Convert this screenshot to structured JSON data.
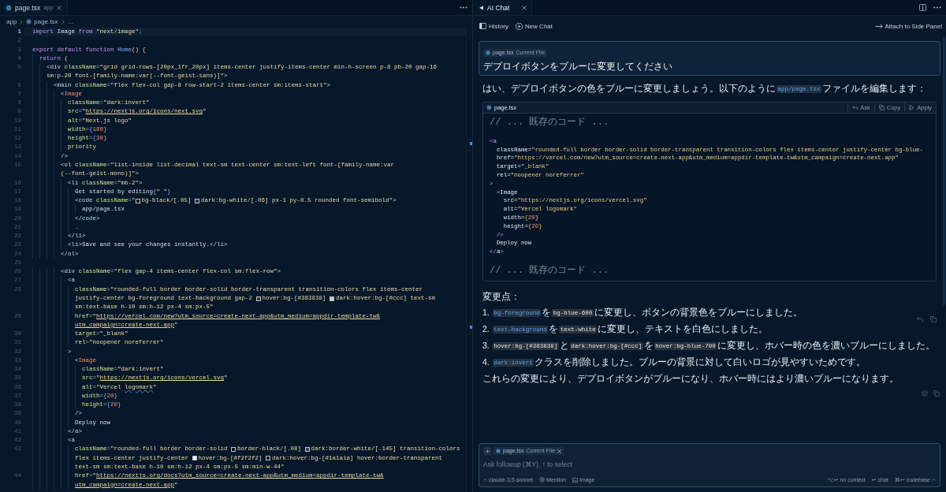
{
  "editor": {
    "tab": {
      "name": "page.tsx",
      "folder": "app",
      "selected": true
    },
    "breadcrumb": {
      "folder": "app",
      "file": "page.tsx",
      "more": "…"
    },
    "lines": [
      {
        "number": "1",
        "current": true,
        "rows": [
          {
            "tokens": [
              {
                "kind": "kw",
                "text": "import"
              },
              {
                "kind": "text",
                "text": " Image "
              },
              {
                "kind": "kw",
                "text": "from "
              },
              {
                "kind": "str",
                "text": "\"next/image\""
              },
              {
                "kind": "punct",
                "text": ";"
              }
            ]
          }
        ]
      },
      {
        "number": "2",
        "current": false
      },
      {
        "number": "3",
        "current": false,
        "rows": [
          {
            "tokens": [
              {
                "kind": "kw",
                "text": "export default function "
              },
              {
                "kind": "fn",
                "text": "Home"
              },
              {
                "kind": "paren",
                "text": "() {"
              }
            ]
          }
        ]
      },
      {
        "number": "4",
        "current": false,
        "rows": [
          {
            "tokens": [
              {
                "kind": "kw",
                "text": "  return "
              },
              {
                "kind": "paren",
                "text": "("
              }
            ]
          }
        ]
      },
      {
        "number": "5",
        "current": false,
        "rows": [
          {
            "tokens": [
              {
                "kind": "tag",
                "text": "    <div "
              },
              {
                "kind": "attr",
                "text": "className"
              },
              {
                "kind": "punct",
                "text": "="
              },
              {
                "kind": "str",
                "text": "\"grid grid-rows-[20px_1fr_20px] items-center justify-items-center min-h-screen p-8 pb-20 gap-16"
              }
            ]
          },
          {
            "tokens": [
              {
                "kind": "str",
                "text": "    sm:p-20 font-[family-name:var(--font-geist-sans)]\""
              },
              {
                "kind": "tag",
                "text": ">"
              }
            ]
          }
        ]
      },
      {
        "number": "6",
        "current": false,
        "rows": [
          {
            "tokens": [
              {
                "kind": "tag",
                "text": "      <main "
              },
              {
                "kind": "attr",
                "text": "className"
              },
              {
                "kind": "punct",
                "text": "="
              },
              {
                "kind": "str",
                "text": "\"flex flex-col gap-8 row-start-2 items-center sm:items-start\""
              },
              {
                "kind": "tag",
                "text": ">"
              }
            ]
          }
        ]
      },
      {
        "number": "7",
        "current": false,
        "rows": [
          {
            "tokens": [
              {
                "kind": "tag",
                "text": "        <"
              },
              {
                "kind": "comp",
                "text": "Image"
              }
            ]
          }
        ]
      },
      {
        "number": "8",
        "current": false,
        "rows": [
          {
            "tokens": [
              {
                "kind": "attr",
                "text": "          className"
              },
              {
                "kind": "punct",
                "text": "="
              },
              {
                "kind": "str",
                "text": "\"dark:invert\""
              }
            ]
          }
        ]
      },
      {
        "number": "9",
        "current": false,
        "rows": [
          {
            "tokens": [
              {
                "kind": "attr",
                "text": "          src"
              },
              {
                "kind": "punct",
                "text": "="
              },
              {
                "kind": "str",
                "text": "\""
              },
              {
                "kind": "url",
                "text": "https://nextjs.org/icons/next.svg"
              },
              {
                "kind": "str",
                "text": "\""
              }
            ]
          }
        ]
      },
      {
        "number": "10",
        "current": false,
        "rows": [
          {
            "tokens": [
              {
                "kind": "attr",
                "text": "          alt"
              },
              {
                "kind": "punct",
                "text": "="
              },
              {
                "kind": "str",
                "text": "\"Next.js logo\""
              }
            ]
          }
        ]
      },
      {
        "number": "11",
        "current": false,
        "rows": [
          {
            "tokens": [
              {
                "kind": "attr",
                "text": "          width"
              },
              {
                "kind": "punct",
                "text": "="
              },
              {
                "kind": "brace",
                "text": "{"
              },
              {
                "kind": "num",
                "text": "180"
              },
              {
                "kind": "brace",
                "text": "}"
              }
            ]
          }
        ]
      },
      {
        "number": "12",
        "current": false,
        "rows": [
          {
            "tokens": [
              {
                "kind": "attr",
                "text": "          height"
              },
              {
                "kind": "punct",
                "text": "="
              },
              {
                "kind": "brace",
                "text": "{"
              },
              {
                "kind": "num",
                "text": "38"
              },
              {
                "kind": "brace",
                "text": "}"
              }
            ]
          }
        ]
      },
      {
        "number": "13",
        "current": false,
        "rows": [
          {
            "tokens": [
              {
                "kind": "attr",
                "text": "          priority"
              }
            ]
          }
        ]
      },
      {
        "number": "14",
        "current": false,
        "rows": [
          {
            "tokens": [
              {
                "kind": "tag",
                "text": "        />"
              }
            ]
          }
        ]
      },
      {
        "number": "15",
        "current": false,
        "rows": [
          {
            "tokens": [
              {
                "kind": "tag",
                "text": "        <ol "
              },
              {
                "kind": "attr",
                "text": "className"
              },
              {
                "kind": "punct",
                "text": "="
              },
              {
                "kind": "str",
                "text": "\"list-inside list-decimal text-sm text-center sm:text-left font-[family-name:var"
              }
            ]
          },
          {
            "tokens": [
              {
                "kind": "str",
                "text": "        (--font-geist-mono)]\""
              },
              {
                "kind": "tag",
                "text": ">"
              }
            ]
          }
        ]
      },
      {
        "number": "16",
        "current": false,
        "rows": [
          {
            "tokens": [
              {
                "kind": "tag",
                "text": "          <li "
              },
              {
                "kind": "attr",
                "text": "className"
              },
              {
                "kind": "punct",
                "text": "="
              },
              {
                "kind": "str",
                "text": "\"mb-2\""
              },
              {
                "kind": "tag",
                "text": ">"
              }
            ]
          }
        ]
      },
      {
        "number": "17",
        "current": false,
        "rows": [
          {
            "tokens": [
              {
                "kind": "text",
                "text": "            Get started by editing"
              },
              {
                "kind": "brace",
                "text": "{"
              },
              {
                "kind": "str",
                "text": "\" \""
              },
              {
                "kind": "brace",
                "text": "}"
              }
            ]
          }
        ]
      },
      {
        "number": "18",
        "current": false,
        "rows": [
          {
            "tokens": [
              {
                "kind": "tag",
                "text": "            <code "
              },
              {
                "kind": "attr",
                "text": "className"
              },
              {
                "kind": "punct",
                "text": "="
              },
              {
                "kind": "str",
                "text": "\""
              },
              {
                "kind": "swatch",
                "color": "#0e1116"
              },
              {
                "kind": "str",
                "text": "bg-black/[.05] "
              },
              {
                "kind": "swatch",
                "color": "#2a2f37"
              },
              {
                "kind": "str",
                "text": "dark:bg-white/[.06] px-1 py-0.5 rounded font-semibold\""
              },
              {
                "kind": "tag",
                "text": ">"
              }
            ]
          }
        ]
      },
      {
        "number": "19",
        "current": false,
        "rows": [
          {
            "tokens": [
              {
                "kind": "text",
                "text": "              app/page.tsx"
              }
            ]
          }
        ]
      },
      {
        "number": "20",
        "current": false,
        "rows": [
          {
            "tokens": [
              {
                "kind": "tag",
                "text": "            </code>"
              }
            ]
          }
        ]
      },
      {
        "number": "21",
        "current": false,
        "rows": [
          {
            "tokens": [
              {
                "kind": "text",
                "text": "            ."
              }
            ]
          }
        ]
      },
      {
        "number": "22",
        "current": false,
        "rows": [
          {
            "tokens": [
              {
                "kind": "tag",
                "text": "          </li>"
              }
            ]
          }
        ]
      },
      {
        "number": "23",
        "current": false,
        "rows": [
          {
            "tokens": [
              {
                "kind": "tag",
                "text": "          <li>"
              },
              {
                "kind": "text",
                "text": "Save and see your changes instantly."
              },
              {
                "kind": "tag",
                "text": "</li>"
              }
            ]
          }
        ]
      },
      {
        "number": "24",
        "current": false,
        "rows": [
          {
            "tokens": [
              {
                "kind": "tag",
                "text": "        </ol>"
              }
            ]
          }
        ]
      },
      {
        "number": "25",
        "current": false
      },
      {
        "number": "26",
        "current": false,
        "rows": [
          {
            "tokens": [
              {
                "kind": "tag",
                "text": "        <div "
              },
              {
                "kind": "attr",
                "text": "className"
              },
              {
                "kind": "punct",
                "text": "="
              },
              {
                "kind": "str",
                "text": "\"flex gap-4 items-center flex-col sm:flex-row\""
              },
              {
                "kind": "tag",
                "text": ">"
              }
            ]
          }
        ]
      },
      {
        "number": "27",
        "current": false,
        "rows": [
          {
            "tokens": [
              {
                "kind": "tag",
                "text": "          <a"
              }
            ]
          }
        ]
      },
      {
        "number": "28",
        "current": false,
        "rows": [
          {
            "tokens": [
              {
                "kind": "attr",
                "text": "            className"
              },
              {
                "kind": "punct",
                "text": "="
              },
              {
                "kind": "str",
                "text": "\"rounded-full border border-solid border-transparent transition-colors flex items-center"
              }
            ]
          },
          {
            "tokens": [
              {
                "kind": "str",
                "text": "            justify-center bg-foreground text-background gap-2 "
              },
              {
                "kind": "swatch",
                "color": "#383838"
              },
              {
                "kind": "str",
                "text": "hover:bg-[#383838] "
              },
              {
                "kind": "swatch",
                "color": "#cccccc"
              },
              {
                "kind": "str",
                "text": "dark:hover:bg-[#ccc] text-sm"
              }
            ]
          },
          {
            "tokens": [
              {
                "kind": "str",
                "text": "            sm:text-base h-10 sm:h-12 px-4 sm:px-5\""
              }
            ]
          }
        ]
      },
      {
        "number": "29",
        "current": false,
        "rows": [
          {
            "tokens": [
              {
                "kind": "attr",
                "text": "            href"
              },
              {
                "kind": "punct",
                "text": "="
              },
              {
                "kind": "str",
                "text": "\""
              },
              {
                "kind": "url",
                "text": "https://vercel.com/new?utm_source=create-next-app&utm_medium=appdir-template-tw&"
              }
            ]
          },
          {
            "tokens": [
              {
                "kind": "url",
                "text": "            utm_campaign=create-next-app"
              },
              {
                "kind": "str",
                "text": "\""
              }
            ]
          }
        ]
      },
      {
        "number": "30",
        "current": false,
        "rows": [
          {
            "tokens": [
              {
                "kind": "attr",
                "text": "            target"
              },
              {
                "kind": "punct",
                "text": "="
              },
              {
                "kind": "str",
                "text": "\"_blank\""
              }
            ]
          }
        ]
      },
      {
        "number": "31",
        "current": false,
        "rows": [
          {
            "tokens": [
              {
                "kind": "attr",
                "text": "            rel"
              },
              {
                "kind": "punct",
                "text": "="
              },
              {
                "kind": "str",
                "text": "\"noopener noreferrer\""
              }
            ]
          }
        ]
      },
      {
        "number": "32",
        "current": false,
        "rows": [
          {
            "tokens": [
              {
                "kind": "tag",
                "text": "          >"
              }
            ]
          }
        ]
      },
      {
        "number": "33",
        "current": false,
        "rows": [
          {
            "tokens": [
              {
                "kind": "tag",
                "text": "            <"
              },
              {
                "kind": "comp",
                "text": "Image"
              }
            ]
          }
        ]
      },
      {
        "number": "34",
        "current": false,
        "rows": [
          {
            "tokens": [
              {
                "kind": "attr",
                "text": "              className"
              },
              {
                "kind": "punct",
                "text": "="
              },
              {
                "kind": "str",
                "text": "\"dark:invert\""
              }
            ]
          }
        ]
      },
      {
        "number": "35",
        "current": false,
        "rows": [
          {
            "tokens": [
              {
                "kind": "attr",
                "text": "              src"
              },
              {
                "kind": "punct",
                "text": "="
              },
              {
                "kind": "str",
                "text": "\""
              },
              {
                "kind": "url",
                "text": "https://nextjs.org/icons/vercel.svg"
              },
              {
                "kind": "str",
                "text": "\""
              }
            ]
          }
        ]
      },
      {
        "number": "36",
        "current": false,
        "rows": [
          {
            "tokens": [
              {
                "kind": "attr",
                "text": "              alt"
              },
              {
                "kind": "punct",
                "text": "="
              },
              {
                "kind": "str",
                "text": "\"Vercel "
              },
              {
                "kind": "typo",
                "text": "logomark"
              },
              {
                "kind": "str",
                "text": "\""
              }
            ]
          }
        ]
      },
      {
        "number": "37",
        "current": false,
        "rows": [
          {
            "tokens": [
              {
                "kind": "attr",
                "text": "              width"
              },
              {
                "kind": "punct",
                "text": "="
              },
              {
                "kind": "brace",
                "text": "{"
              },
              {
                "kind": "num",
                "text": "20"
              },
              {
                "kind": "brace",
                "text": "}"
              }
            ]
          }
        ]
      },
      {
        "number": "38",
        "current": false,
        "rows": [
          {
            "tokens": [
              {
                "kind": "attr",
                "text": "              height"
              },
              {
                "kind": "punct",
                "text": "="
              },
              {
                "kind": "brace",
                "text": "{"
              },
              {
                "kind": "num",
                "text": "20"
              },
              {
                "kind": "brace",
                "text": "}"
              }
            ]
          }
        ]
      },
      {
        "number": "39",
        "current": false,
        "rows": [
          {
            "tokens": [
              {
                "kind": "tag",
                "text": "            />"
              }
            ]
          }
        ]
      },
      {
        "number": "40",
        "current": false,
        "rows": [
          {
            "tokens": [
              {
                "kind": "text",
                "text": "            Deploy now"
              }
            ]
          }
        ]
      },
      {
        "number": "41",
        "current": false,
        "rows": [
          {
            "tokens": [
              {
                "kind": "tag",
                "text": "          </a>"
              }
            ]
          }
        ]
      },
      {
        "number": "42",
        "current": false,
        "rows": [
          {
            "tokens": [
              {
                "kind": "tag",
                "text": "          <a"
              }
            ]
          }
        ]
      },
      {
        "number": "43",
        "current": false,
        "rows": [
          {
            "tokens": [
              {
                "kind": "attr",
                "text": "            className"
              },
              {
                "kind": "punct",
                "text": "="
              },
              {
                "kind": "str",
                "text": "\"rounded-full border border-solid "
              },
              {
                "kind": "swatch",
                "color": "#14171c"
              },
              {
                "kind": "str",
                "text": "border-black/[.08] "
              },
              {
                "kind": "swatch",
                "color": "#3b4048"
              },
              {
                "kind": "str",
                "text": "dark:border-white/[.145] transition-colors"
              }
            ]
          },
          {
            "tokens": [
              {
                "kind": "str",
                "text": "            flex items-center justify-center "
              },
              {
                "kind": "swatch",
                "color": "#f2f2f2"
              },
              {
                "kind": "str",
                "text": "hover:bg-[#f2f2f2] "
              },
              {
                "kind": "swatch",
                "color": "#1a1a1a"
              },
              {
                "kind": "str",
                "text": "dark:hover:bg-[#1a1a1a] hover:border-transparent"
              }
            ]
          },
          {
            "tokens": [
              {
                "kind": "str",
                "text": "            text-sm sm:text-base h-10 sm:h-12 px-4 sm:px-5 sm:min-w-44\""
              }
            ]
          }
        ]
      },
      {
        "number": "44",
        "current": false,
        "rows": [
          {
            "tokens": [
              {
                "kind": "attr",
                "text": "            href"
              },
              {
                "kind": "punct",
                "text": "="
              },
              {
                "kind": "str",
                "text": "\""
              },
              {
                "kind": "url",
                "text": "https://nextjs.org/docs?utm_source=create-next-app&utm_medium=appdir-template-tw&"
              }
            ]
          },
          {
            "tokens": [
              {
                "kind": "url",
                "text": "            utm_campaign=create-next-app"
              },
              {
                "kind": "str",
                "text": "\""
              }
            ]
          }
        ]
      }
    ]
  },
  "chat": {
    "tab": {
      "label": "AI Chat",
      "selected": true
    },
    "toolbar": {
      "history": "History",
      "new_chat": "New Chat",
      "attach": "Attach to Side Panel"
    },
    "request": {
      "file": {
        "name": "page.tsx",
        "tag": "Current File"
      },
      "text": "デプロイボタンをブルーに変更してください"
    },
    "reply": {
      "intro": [
        {
          "kind": "text",
          "text": "はい、デプロイボタンの色をブルーに変更しましょう。以下のように"
        },
        {
          "kind": "link",
          "text": "app/page.tsx"
        },
        {
          "kind": "text",
          "text": "ファイルを編集します："
        }
      ],
      "code_block": {
        "file": "page.tsx",
        "actions": [
          {
            "kind": "ask",
            "label": "Ask"
          },
          {
            "kind": "copy",
            "label": "Copy"
          },
          {
            "kind": "apply",
            "label": "Apply"
          }
        ],
        "lines": [
          {
            "kind": "code",
            "tokens": [
              {
                "kind": "comment",
                "text": "// ... 既存のコード ..."
              }
            ]
          },
          {
            "kind": "blank"
          },
          {
            "kind": "code",
            "tokens": [
              {
                "kind": "tag",
                "text": "<a"
              }
            ]
          },
          {
            "kind": "code",
            "tokens": [
              {
                "kind": "attr",
                "text": "  className"
              },
              {
                "kind": "punct",
                "text": "="
              },
              {
                "kind": "str",
                "text": "\"rounded-full border border-solid border-transparent transition-colors flex items-center justify-center bg-blue-"
              }
            ]
          },
          {
            "kind": "code",
            "tokens": [
              {
                "kind": "attr",
                "text": "  href"
              },
              {
                "kind": "punct",
                "text": "="
              },
              {
                "kind": "str",
                "text": "\"https://vercel.com/new?utm_source=create-next-app&utm_medium=appdir-template-tw&utm_campaign=create-next-app\""
              }
            ]
          },
          {
            "kind": "code",
            "tokens": [
              {
                "kind": "attr",
                "text": "  target"
              },
              {
                "kind": "punct",
                "text": "="
              },
              {
                "kind": "str",
                "text": "\"_blank\""
              }
            ]
          },
          {
            "kind": "code",
            "tokens": [
              {
                "kind": "attr",
                "text": "  rel"
              },
              {
                "kind": "punct",
                "text": "="
              },
              {
                "kind": "str",
                "text": "\"noopener noreferrer\""
              }
            ]
          },
          {
            "kind": "code",
            "tokens": [
              {
                "kind": "tag",
                "text": ">"
              }
            ]
          },
          {
            "kind": "code",
            "tokens": [
              {
                "kind": "tag",
                "text": "  <"
              },
              {
                "kind": "text",
                "text": "Image"
              }
            ]
          },
          {
            "kind": "code",
            "tokens": [
              {
                "kind": "attr",
                "text": "    src"
              },
              {
                "kind": "punct",
                "text": "="
              },
              {
                "kind": "str",
                "text": "\"https://nextjs.org/icons/vercel.svg\""
              }
            ]
          },
          {
            "kind": "code",
            "tokens": [
              {
                "kind": "attr",
                "text": "    alt"
              },
              {
                "kind": "punct",
                "text": "="
              },
              {
                "kind": "str",
                "text": "\"Vercel logomark\""
              }
            ]
          },
          {
            "kind": "code",
            "tokens": [
              {
                "kind": "attr",
                "text": "    width"
              },
              {
                "kind": "punct",
                "text": "="
              },
              {
                "kind": "brace",
                "text": "{"
              },
              {
                "kind": "num",
                "text": "20"
              },
              {
                "kind": "brace",
                "text": "}"
              }
            ]
          },
          {
            "kind": "code",
            "tokens": [
              {
                "kind": "attr",
                "text": "    height"
              },
              {
                "kind": "punct",
                "text": "="
              },
              {
                "kind": "brace",
                "text": "{"
              },
              {
                "kind": "num",
                "text": "20"
              },
              {
                "kind": "brace",
                "text": "}"
              }
            ]
          },
          {
            "kind": "code",
            "tokens": [
              {
                "kind": "tag",
                "text": "  />"
              }
            ]
          },
          {
            "kind": "code",
            "tokens": [
              {
                "kind": "text",
                "text": "  Deploy now"
              }
            ]
          },
          {
            "kind": "code",
            "tokens": [
              {
                "kind": "tag",
                "text": "</"
              },
              {
                "kind": "text",
                "text": "a"
              },
              {
                "kind": "tag",
                "text": ">"
              }
            ]
          },
          {
            "kind": "blank"
          },
          {
            "kind": "code",
            "tokens": [
              {
                "kind": "comment",
                "text": "// ... 既存のコード ..."
              }
            ]
          }
        ]
      },
      "changes_title": "変更点：",
      "changes": [
        {
          "number": "1.",
          "parts": [
            {
              "kind": "link",
              "text": "bg-foreground"
            },
            {
              "kind": "text",
              "text": "を"
            },
            {
              "kind": "code",
              "text": "bg-blue-600"
            },
            {
              "kind": "text",
              "text": "に変更し、ボタンの背景色をブルーにしました。"
            }
          ]
        },
        {
          "number": "2.",
          "parts": [
            {
              "kind": "link",
              "text": "text-background"
            },
            {
              "kind": "text",
              "text": "を"
            },
            {
              "kind": "code",
              "text": "text-white"
            },
            {
              "kind": "text",
              "text": "に変更し、テキストを白色にしました。"
            }
          ]
        },
        {
          "number": "3.",
          "parts": [
            {
              "kind": "code",
              "text": "hover:bg-[#383838]"
            },
            {
              "kind": "text",
              "text": "と"
            },
            {
              "kind": "code",
              "text": "dark:hover:bg-[#ccc]"
            },
            {
              "kind": "text",
              "text": "を"
            },
            {
              "kind": "code",
              "text": "hover:bg-blue-700"
            },
            {
              "kind": "text",
              "text": "に変更し、ホバー時の色を濃いブルーにしました。"
            }
          ]
        },
        {
          "number": "4.",
          "parts": [
            {
              "kind": "link",
              "text": "dark:invert"
            },
            {
              "kind": "text",
              "text": "クラスを削除しました。ブルーの背景に対して白いロゴが見やすいためです。"
            }
          ]
        }
      ],
      "summary": "これらの変更により、デプロイボタンがブルーになり、ホバー時にはより濃いブルーになります。"
    },
    "composer": {
      "file": {
        "name": "page.tsx",
        "tag": "Current File"
      },
      "placeholder": "Ask followup (⌘Y), ↑ to select",
      "model": "claude-3.5-sonnet",
      "mention": "Mention",
      "image": "Image",
      "shortcuts": [
        {
          "kind": "action",
          "label": "⌥↩ no context"
        },
        {
          "kind": "action",
          "label": "↩ chat"
        },
        {
          "kind": "menu",
          "label": "⌘↩ codebase"
        }
      ]
    }
  }
}
